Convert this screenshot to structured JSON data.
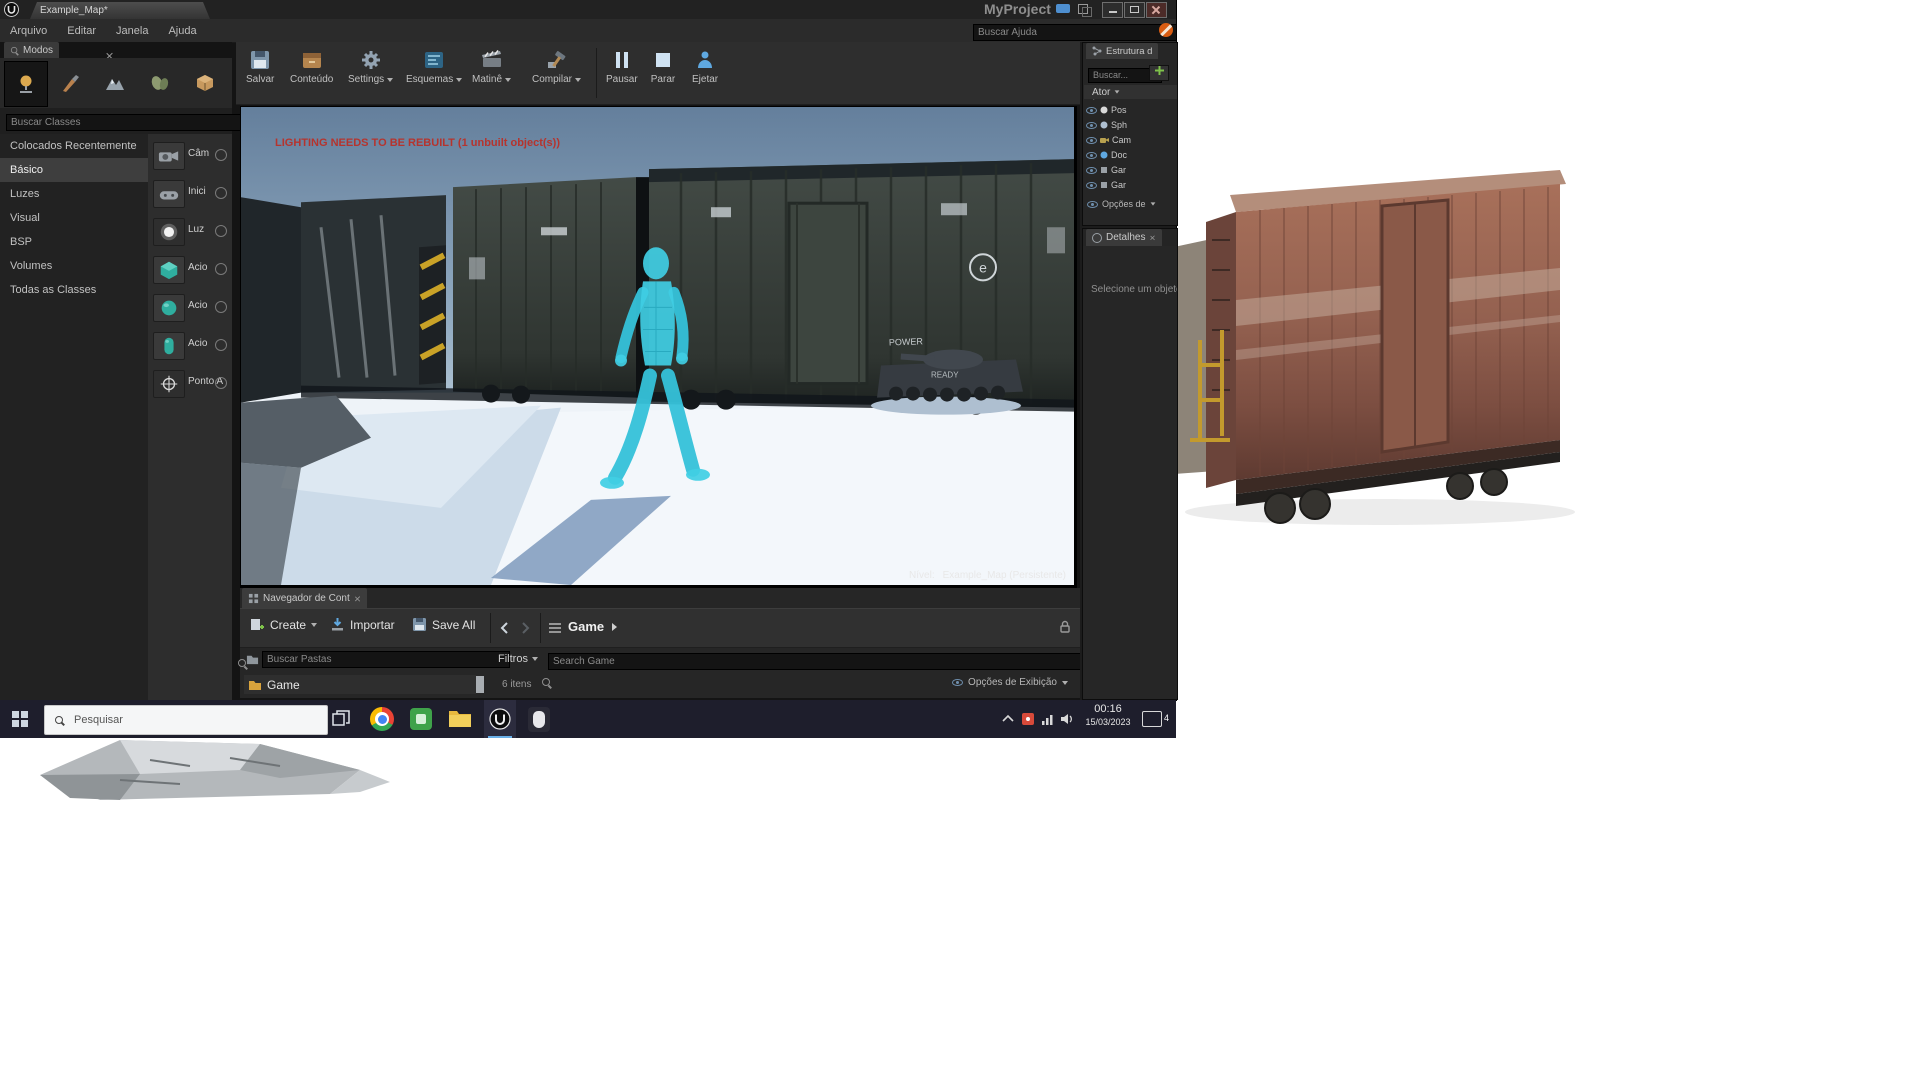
{
  "titlebar": {
    "tab": "Example_Map*",
    "project": "MyProject"
  },
  "menubar": {
    "items": [
      "Arquivo",
      "Editar",
      "Janela",
      "Ajuda"
    ],
    "search_placeholder": "Buscar Ajuda"
  },
  "modes": {
    "tab": "Modos",
    "search_placeholder": "Buscar Classes",
    "categories": [
      "Colocados Recentemente",
      "Básico",
      "Luzes",
      "Visual",
      "BSP",
      "Volumes",
      "Todas as Classes"
    ],
    "items": [
      {
        "label": "Câm"
      },
      {
        "label": "Inici"
      },
      {
        "label": "Luz"
      },
      {
        "label": "Acio"
      },
      {
        "label": "Acio"
      },
      {
        "label": "Acio"
      },
      {
        "label": "Ponto A"
      }
    ]
  },
  "toolbar": {
    "save": "Salvar",
    "content": "Conteúdo",
    "settings": "Settings",
    "blueprints": "Esquemas",
    "matinee": "Matinê",
    "build": "Compilar",
    "pause": "Pausar",
    "stop": "Parar",
    "eject": "Ejetar"
  },
  "viewport": {
    "warning": "LIGHTING NEEDS TO BE REBUILT (1 unbuilt object(s))",
    "level_label": "Nível:",
    "level_value": "Example_Map (Persistente)",
    "markings": {
      "circle_e": "e",
      "power": "POWER",
      "ready": "READY"
    }
  },
  "outliner": {
    "tab": "Estrutura d",
    "search_placeholder": "Buscar...",
    "column_header": "Ator",
    "rows": [
      {
        "name": "Pos"
      },
      {
        "name": "Sph"
      },
      {
        "name": "Cam"
      },
      {
        "name": "Doc"
      },
      {
        "name": "Gar"
      },
      {
        "name": "Gar"
      }
    ],
    "footer": "Opções de"
  },
  "details": {
    "tab": "Detalhes",
    "empty": "Selecione um objeto"
  },
  "content_browser": {
    "tab": "Navegador de Cont",
    "create": "Create",
    "import": "Importar",
    "save_all": "Save All",
    "path": "Game",
    "filters": "Filtros",
    "search_placeholder": "Search Game",
    "folder_search_placeholder": "Buscar Pastas",
    "folder": "Game",
    "item_count": "6 itens",
    "view_options": "Opções de Exibição"
  },
  "taskbar": {
    "search_placeholder": "Pesquisar",
    "clock_time": "00:16",
    "clock_date": "15/03/2023",
    "notification_badge": "4"
  }
}
